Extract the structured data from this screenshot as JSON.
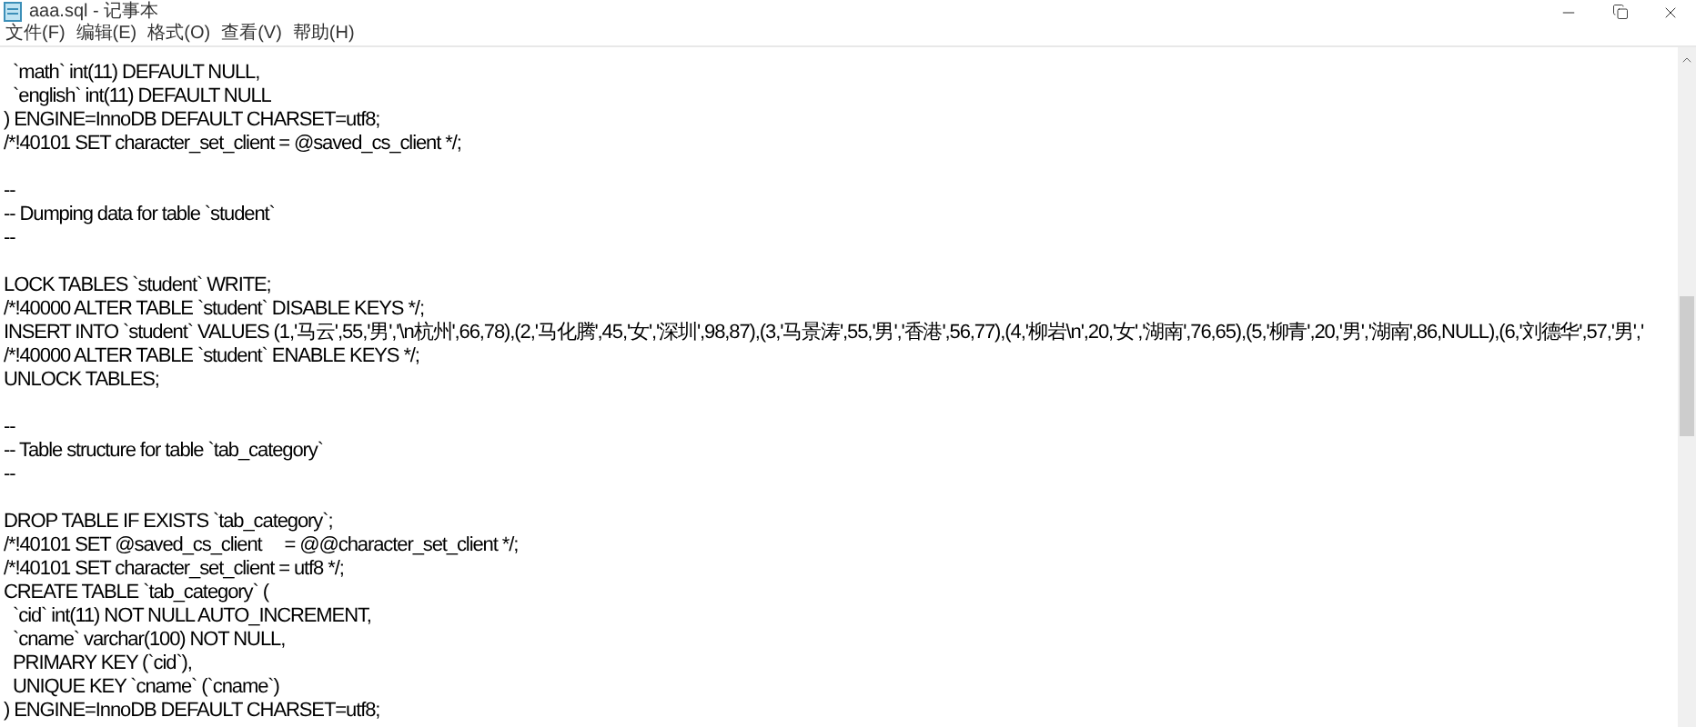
{
  "window": {
    "title": "aaa.sql - 记事本"
  },
  "menu": [
    {
      "label": "文件(F)"
    },
    {
      "label": "编辑(E)"
    },
    {
      "label": "格式(O)"
    },
    {
      "label": "查看(V)"
    },
    {
      "label": "帮助(H)"
    }
  ],
  "editor": {
    "lines": [
      {
        "kind": "code",
        "text": "  `math` int(11) DEFAULT NULL,"
      },
      {
        "kind": "code",
        "text": "  `english` int(11) DEFAULT NULL"
      },
      {
        "kind": "code",
        "text": ") ENGINE=InnoDB DEFAULT CHARSET=utf8;"
      },
      {
        "kind": "code",
        "text": "/*!40101 SET character_set_client = @saved_cs_client */;"
      },
      {
        "kind": "blank"
      },
      {
        "kind": "code",
        "text": "--"
      },
      {
        "kind": "code",
        "text": "-- Dumping data for table `student`"
      },
      {
        "kind": "code",
        "text": "--"
      },
      {
        "kind": "blank"
      },
      {
        "kind": "code",
        "text": "LOCK TABLES `student` WRITE;"
      },
      {
        "kind": "code",
        "text": "/*!40000 ALTER TABLE `student` DISABLE KEYS */;"
      },
      {
        "kind": "code",
        "text": "INSERT INTO `student` VALUES (1,'马云',55,'男','\\n杭州',66,78),(2,'马化腾',45,'女','深圳',98,87),(3,'马景涛',55,'男','香港',56,77),(4,'柳岩\\n',20,'女','湖南',76,65),(5,'柳青',20,'男','湖南',86,NULL),(6,'刘德华',57,'男','"
      },
      {
        "kind": "code",
        "text": "/*!40000 ALTER TABLE `student` ENABLE KEYS */;"
      },
      {
        "kind": "code",
        "text": "UNLOCK TABLES;"
      },
      {
        "kind": "blank"
      },
      {
        "kind": "code",
        "text": "--"
      },
      {
        "kind": "code",
        "text": "-- Table structure for table `tab_category`"
      },
      {
        "kind": "code",
        "text": "--"
      },
      {
        "kind": "blank"
      },
      {
        "kind": "code",
        "text": "DROP TABLE IF EXISTS `tab_category`;"
      },
      {
        "kind": "code",
        "text": "/*!40101 SET @saved_cs_client     = @@character_set_client */;"
      },
      {
        "kind": "code",
        "text": "/*!40101 SET character_set_client = utf8 */;"
      },
      {
        "kind": "code",
        "text": "CREATE TABLE `tab_category` ("
      },
      {
        "kind": "code",
        "text": "  `cid` int(11) NOT NULL AUTO_INCREMENT,"
      },
      {
        "kind": "code",
        "text": "  `cname` varchar(100) NOT NULL,"
      },
      {
        "kind": "code",
        "text": "  PRIMARY KEY (`cid`),"
      },
      {
        "kind": "code",
        "text": "  UNIQUE KEY `cname` (`cname`)"
      },
      {
        "kind": "code",
        "text": ") ENGINE=InnoDB DEFAULT CHARSET=utf8;"
      }
    ]
  }
}
